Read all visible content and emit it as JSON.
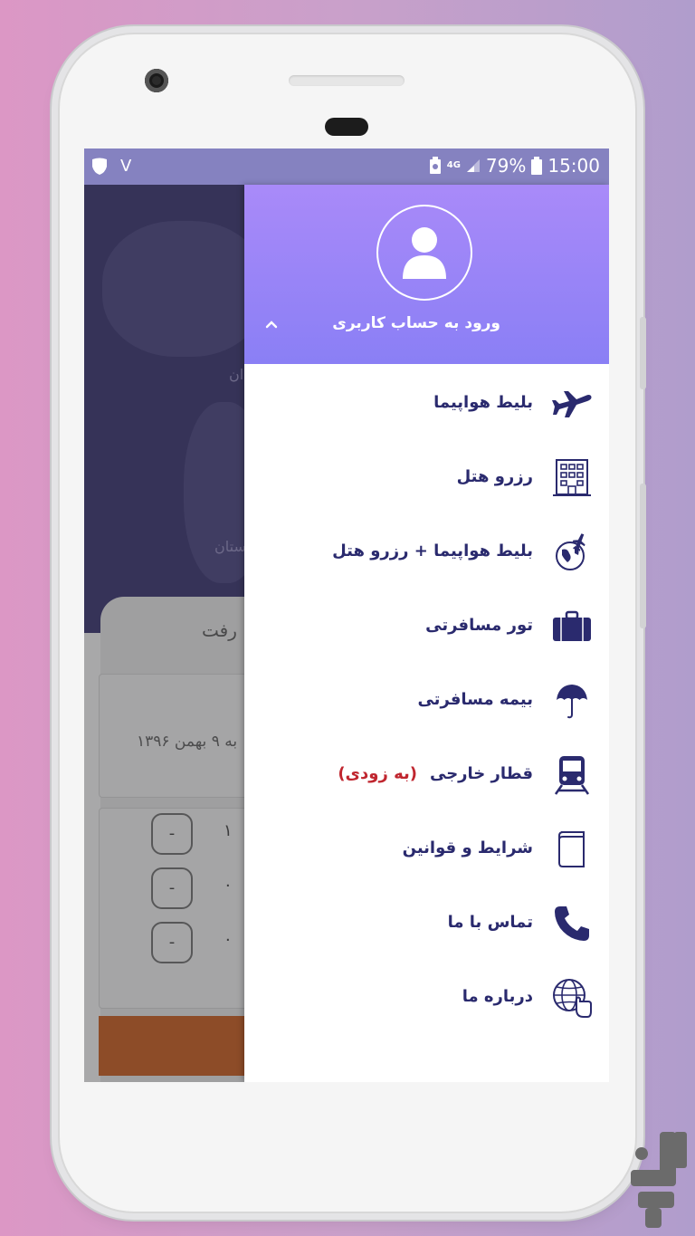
{
  "status_bar": {
    "left_indicator": "V",
    "network": "4G",
    "battery": "79%",
    "time": "15:00",
    "background": "#8582c0"
  },
  "background_app": {
    "map_labels": [
      "ان",
      "ستان"
    ],
    "trip_tab_label": "رفت",
    "date_text": "به ۹ بهمن ۱۳۹۶",
    "passenger_counts": [
      "۱",
      "۰",
      "۰"
    ],
    "minus_label": "-"
  },
  "drawer": {
    "header": {
      "login_label": "ورود به حساب کاربری",
      "avatar_icon": "user-avatar-icon",
      "gradient_top": "#a98af9",
      "gradient_bottom": "#8a7ff5"
    },
    "items": [
      {
        "label": "بلیط هواپیما",
        "icon": "airplane-icon"
      },
      {
        "label": "رزرو هتل",
        "icon": "hotel-building-icon"
      },
      {
        "label": "بلیط هواپیما + رزرو هتل",
        "icon": "globe-plane-icon"
      },
      {
        "label": "تور مسافرتی",
        "icon": "suitcase-icon"
      },
      {
        "label": "بیمه مسافرتی",
        "icon": "umbrella-icon"
      },
      {
        "label": "قطار خارجی",
        "badge": "(به زودی)",
        "icon": "train-icon"
      },
      {
        "label": "شرایط و قوانین",
        "icon": "book-icon"
      },
      {
        "label": "تماس با ما",
        "icon": "phone-icon"
      },
      {
        "label": "درباره ما",
        "icon": "globe-hand-icon"
      }
    ],
    "accent_color": "#2a2a6e",
    "badge_color": "#c0262f"
  }
}
